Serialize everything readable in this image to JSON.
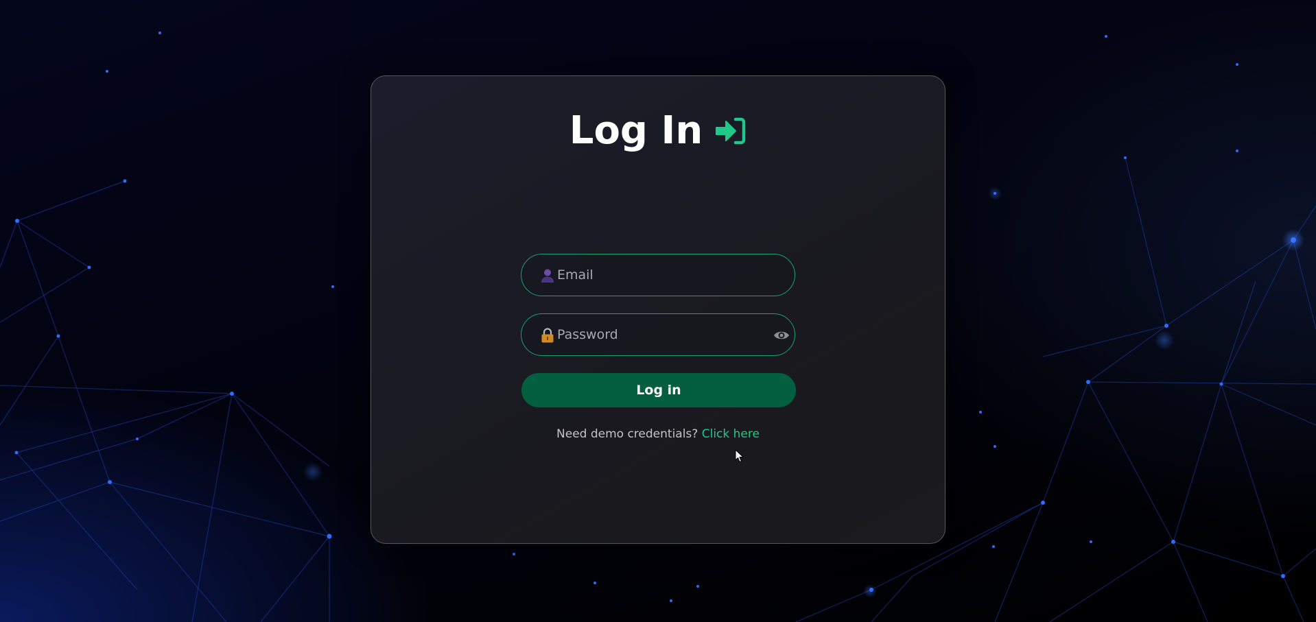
{
  "login": {
    "title": "Log In",
    "title_icon": "sign-in-icon",
    "email": {
      "icon": "user-icon",
      "placeholder": "Email",
      "value": ""
    },
    "password": {
      "icon": "lock-icon",
      "placeholder": "Password",
      "value": "",
      "toggle_icon": "eye-icon"
    },
    "submit_label": "Log in",
    "demo_prompt": "Need demo credentials?",
    "demo_link": "Click here"
  },
  "colors": {
    "accent": "#1fc98a",
    "field_border": "#17a571",
    "button_bg": "#045f41",
    "card_border": "#55585f",
    "background_dark": "#02030f"
  }
}
